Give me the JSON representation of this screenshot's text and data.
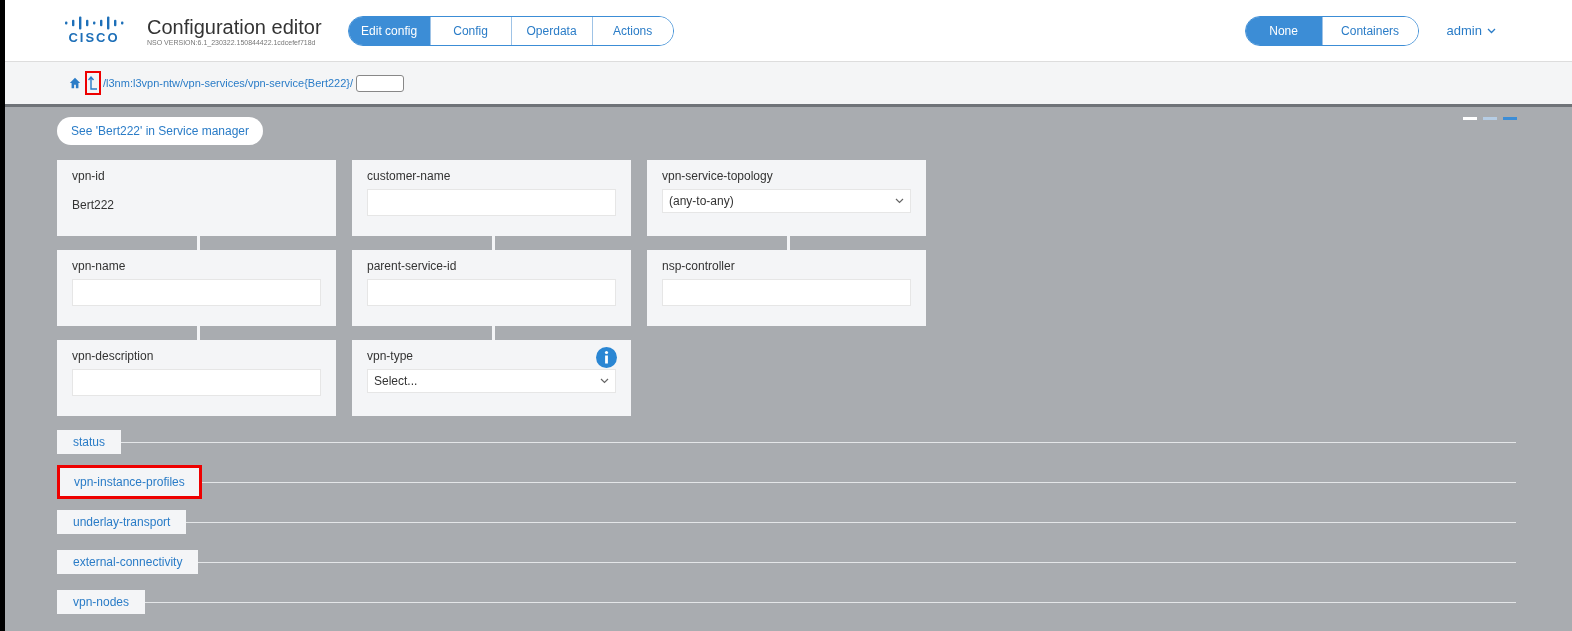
{
  "header": {
    "logo": "CISCO",
    "title": "Configuration editor",
    "version": "NSO VERSION:6.1_230322.150844422.1cdcefef718d",
    "tabs": [
      {
        "label": "Edit config",
        "selected": true
      },
      {
        "label": "Config",
        "selected": false
      },
      {
        "label": "Operdata",
        "selected": false
      },
      {
        "label": "Actions",
        "selected": false
      }
    ],
    "view_toggle": [
      {
        "label": "None",
        "selected": true
      },
      {
        "label": "Containers",
        "selected": false
      }
    ],
    "user": "admin"
  },
  "breadcrumb": {
    "up_highlighted": true,
    "path": "/l3nm:l3vpn-ntw/vpn-services/vpn-service{Bert222}/"
  },
  "service_manager_link": "See 'Bert222' in Service manager",
  "pager": [
    {
      "selected": false
    },
    {
      "selected": false
    },
    {
      "selected": true
    }
  ],
  "fields": [
    {
      "label": "vpn-id",
      "kind": "text",
      "value": "Bert222"
    },
    {
      "label": "customer-name",
      "kind": "input"
    },
    {
      "label": "vpn-service-topology",
      "kind": "select",
      "value": "(any-to-any)"
    },
    {
      "label": "vpn-name",
      "kind": "input"
    },
    {
      "label": "parent-service-id",
      "kind": "input"
    },
    {
      "label": "nsp-controller",
      "kind": "input"
    },
    {
      "label": "vpn-description",
      "kind": "input"
    },
    {
      "label": "vpn-type",
      "kind": "select",
      "value": "Select...",
      "info": true
    }
  ],
  "sections": [
    {
      "label": "status",
      "highlighted": false
    },
    {
      "label": "vpn-instance-profiles",
      "highlighted": true
    },
    {
      "label": "underlay-transport",
      "highlighted": false
    },
    {
      "label": "external-connectivity",
      "highlighted": false
    },
    {
      "label": "vpn-nodes",
      "highlighted": false
    }
  ]
}
